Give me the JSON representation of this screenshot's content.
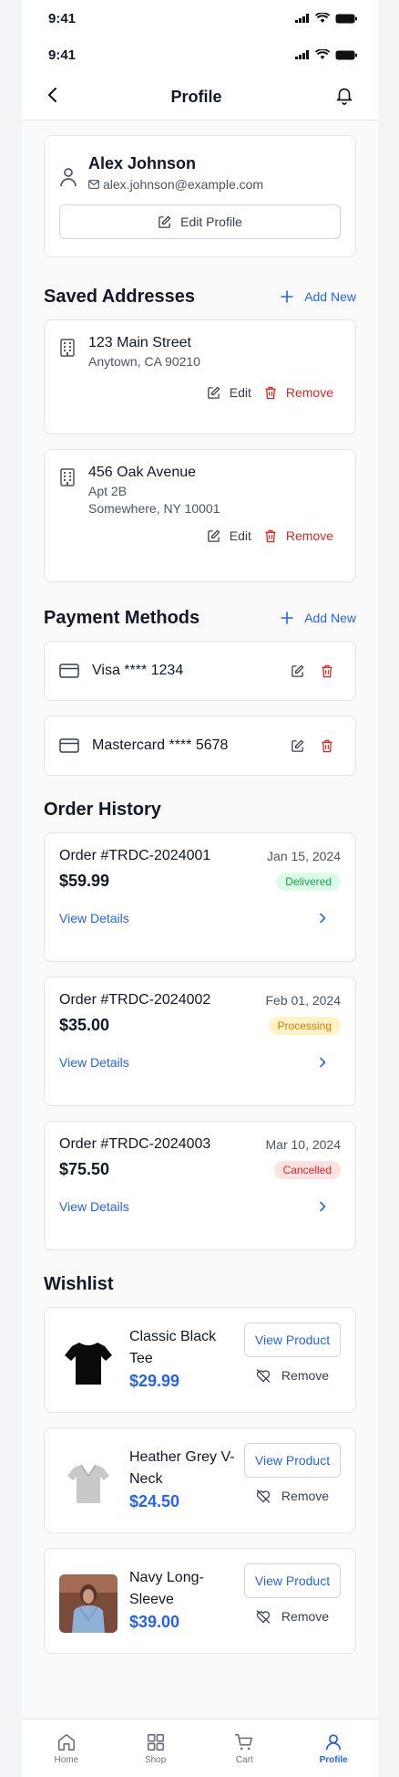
{
  "status_bar": {
    "time": "9:41"
  },
  "header": {
    "title": "Profile"
  },
  "profile": {
    "name": "Alex Johnson",
    "email": "alex.johnson@example.com",
    "edit_label": "Edit Profile"
  },
  "addresses": {
    "title": "Saved Addresses",
    "add_label": "Add New",
    "edit_label": "Edit",
    "remove_label": "Remove",
    "items": [
      {
        "line1": "123 Main Street",
        "line2": "Anytown, CA 90210"
      },
      {
        "line1": "456 Oak Avenue",
        "line2": "Apt 2B",
        "line3": "Somewhere, NY 10001"
      }
    ]
  },
  "payments": {
    "title": "Payment Methods",
    "add_label": "Add New",
    "items": [
      {
        "label": "Visa **** 1234"
      },
      {
        "label": "Mastercard **** 5678"
      }
    ]
  },
  "orders": {
    "title": "Order History",
    "view_label": "View Details",
    "items": [
      {
        "id": "Order #TRDC-2024001",
        "date": "Jan 15, 2024",
        "total": "$59.99",
        "status": "Delivered",
        "status_bg": "#dcfce7",
        "status_fg": "#16a34a"
      },
      {
        "id": "Order #TRDC-2024002",
        "date": "Feb 01, 2024",
        "total": "$35.00",
        "status": "Processing",
        "status_bg": "#fef3c7",
        "status_fg": "#d97706"
      },
      {
        "id": "Order #TRDC-2024003",
        "date": "Mar 10, 2024",
        "total": "$75.50",
        "status": "Cancelled",
        "status_bg": "#fee2e2",
        "status_fg": "#dc2626"
      }
    ]
  },
  "wishlist": {
    "title": "Wishlist",
    "view_label": "View Product",
    "remove_label": "Remove",
    "items": [
      {
        "name": "Classic Black Tee",
        "price": "$29.99"
      },
      {
        "name": "Heather Grey V-Neck",
        "price": "$24.50"
      },
      {
        "name": "Navy Long-Sleeve",
        "price": "$39.00"
      }
    ]
  },
  "tabs": [
    {
      "label": "Home",
      "icon": "home-icon"
    },
    {
      "label": "Shop",
      "icon": "grid-icon"
    },
    {
      "label": "Cart",
      "icon": "cart-icon"
    },
    {
      "label": "Profile",
      "icon": "user-icon",
      "active": true
    }
  ],
  "colors": {
    "accent": "#2563eb",
    "danger": "#dc2626"
  }
}
